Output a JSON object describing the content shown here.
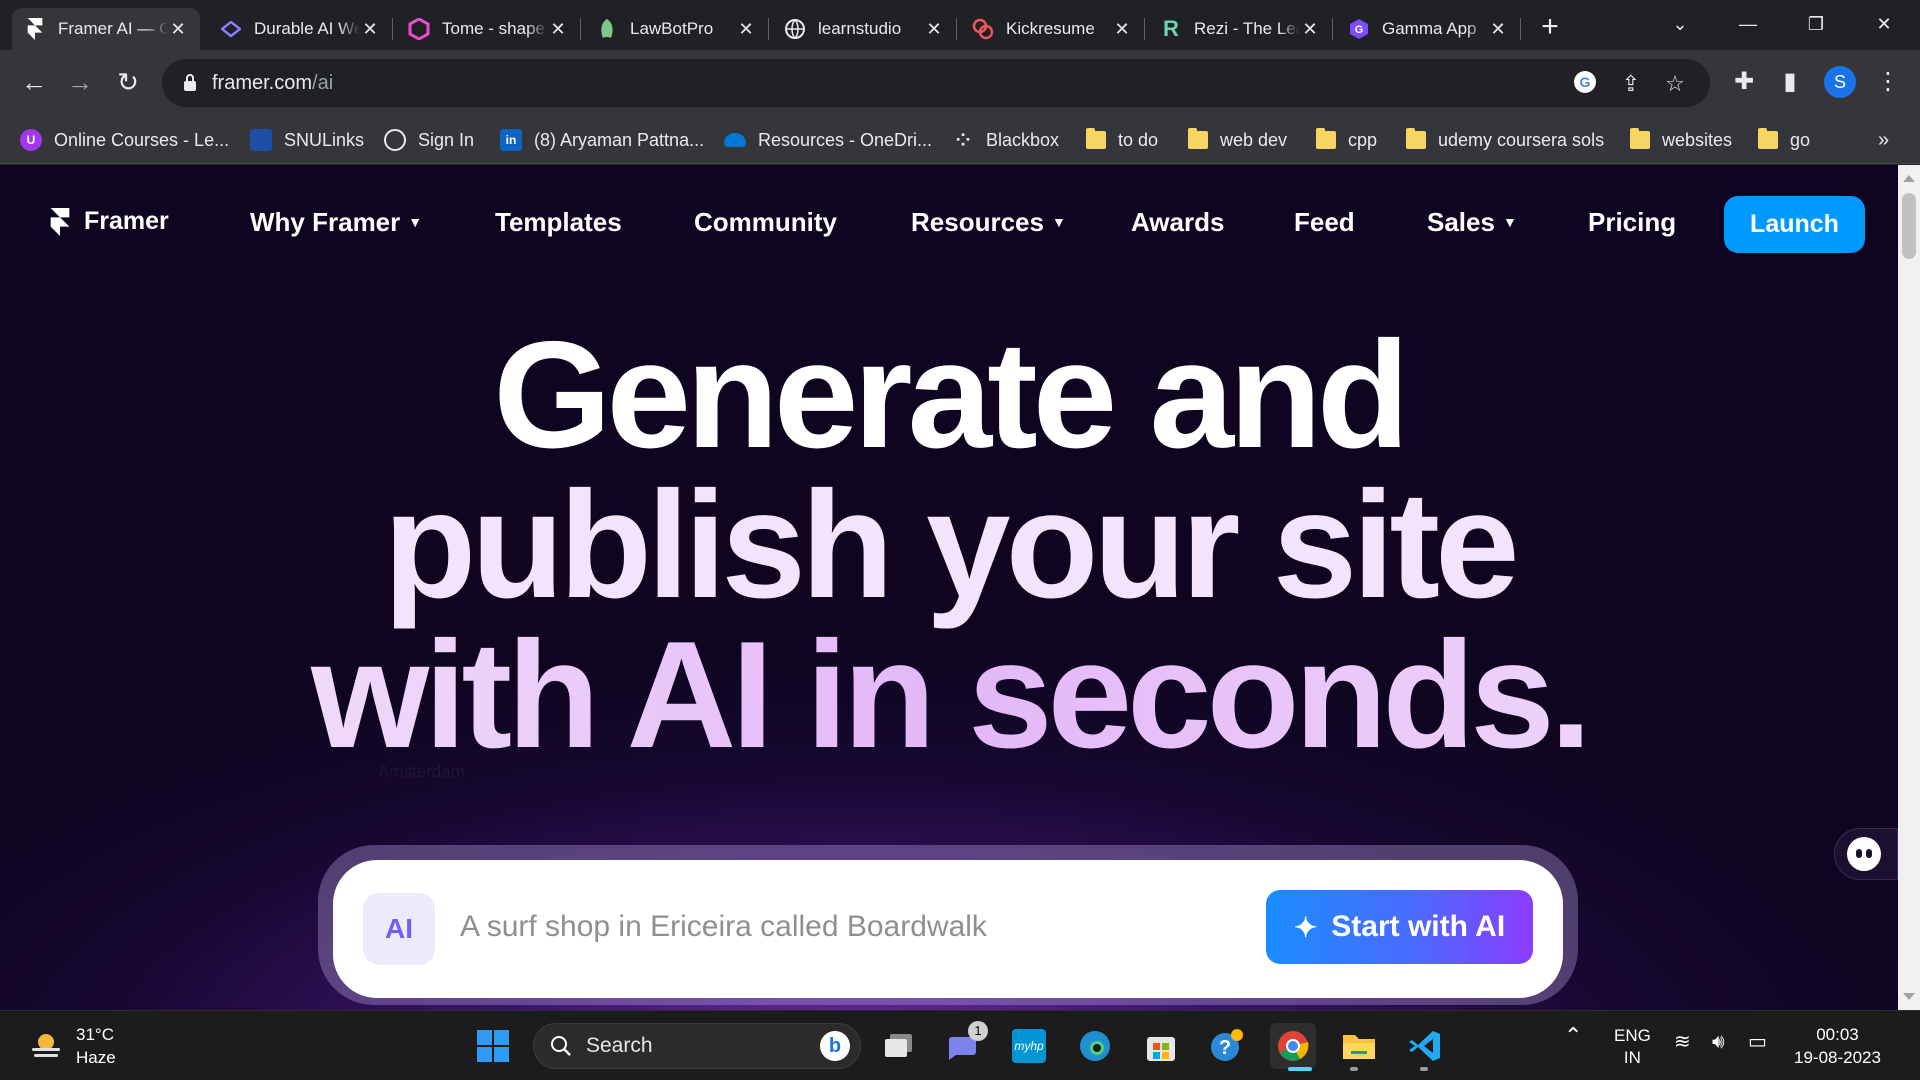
{
  "tabs": [
    {
      "title": "Framer AI — Generate and publish your site",
      "favicon": "framer-icon",
      "active": true
    },
    {
      "title": "Durable AI Website Builder",
      "favicon": "durable-icon"
    },
    {
      "title": "Tome - shape your ideas",
      "favicon": "tome-icon"
    },
    {
      "title": "LawBotPro",
      "favicon": "lawbotpro-icon"
    },
    {
      "title": "learnstudio",
      "favicon": "globe-icon"
    },
    {
      "title": "Kickresume",
      "favicon": "kickresume-icon"
    },
    {
      "title": "Rezi - The Leading AI Resume Builder",
      "favicon": "rezi-icon"
    },
    {
      "title": "Gamma App",
      "favicon": "gamma-icon"
    }
  ],
  "address": {
    "host": "framer.com",
    "path": "/ai"
  },
  "bookmarks": [
    {
      "label": "Online Courses - Le...",
      "icon": "udemy-icon"
    },
    {
      "label": "SNULinks",
      "icon": "snu-icon"
    },
    {
      "label": "Sign In",
      "icon": "globe-icon"
    },
    {
      "label": "(8) Aryaman Pattna...",
      "icon": "linkedin-icon"
    },
    {
      "label": "Resources - OneDri...",
      "icon": "onedrive-icon"
    },
    {
      "label": "Blackbox",
      "icon": "blackbox-icon"
    },
    {
      "label": "to do",
      "icon": "folder-icon"
    },
    {
      "label": "web dev",
      "icon": "folder-icon"
    },
    {
      "label": "cpp",
      "icon": "folder-icon"
    },
    {
      "label": "udemy coursera sols",
      "icon": "folder-icon"
    },
    {
      "label": "websites",
      "icon": "folder-icon"
    },
    {
      "label": "go",
      "icon": "folder-icon"
    }
  ],
  "profile_initial": "S",
  "site": {
    "brand": "Framer",
    "nav": [
      {
        "label": "Why Framer",
        "dropdown": true
      },
      {
        "label": "Templates",
        "dropdown": false
      },
      {
        "label": "Community",
        "dropdown": false
      },
      {
        "label": "Resources",
        "dropdown": true
      },
      {
        "label": "Awards",
        "dropdown": false
      },
      {
        "label": "Feed",
        "dropdown": false
      },
      {
        "label": "Sales",
        "dropdown": true
      },
      {
        "label": "Pricing",
        "dropdown": false
      }
    ],
    "launch_label": "Launch",
    "hero": {
      "line1": "Generate and",
      "line2": "publish your site",
      "line3": "with AI in seconds."
    },
    "ghost_text": "Amsterdam",
    "prompt": {
      "badge": "AI",
      "placeholder": "A surf shop in Ericeira called Boardwalk",
      "button_label": "Start with AI"
    }
  },
  "taskbar": {
    "weather": {
      "temp": "31°C",
      "condition": "Haze"
    },
    "search_label": "Search",
    "teams_badge": "1",
    "lang": {
      "line1": "ENG",
      "line2": "IN"
    },
    "clock": {
      "time": "00:03",
      "date": "19-08-2023"
    }
  },
  "colors": {
    "launch_button": "#0099ff",
    "page_bg": "#0f0520",
    "hero_accent": "#e3b7f7"
  }
}
